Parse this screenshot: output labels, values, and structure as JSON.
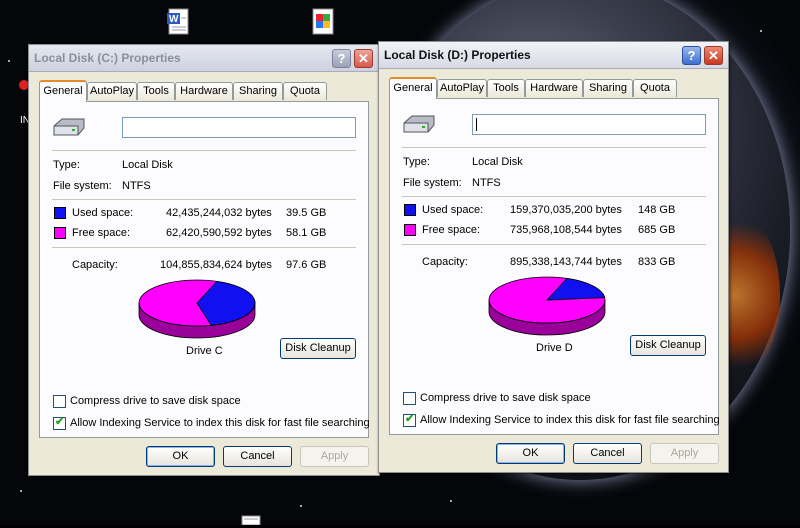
{
  "desktop": {
    "icons": [
      {
        "name": "word-document-icon"
      },
      {
        "name": "shortcut-icon"
      },
      {
        "name": "red-program-icon"
      },
      {
        "name": "notepad-icon"
      }
    ],
    "partial_label": "IN"
  },
  "windows": [
    {
      "title": "Local Disk (C:) Properties",
      "tabs": [
        "General",
        "AutoPlay",
        "Tools",
        "Hardware",
        "Sharing",
        "Quota"
      ],
      "selected_tab": "General",
      "name_value": "",
      "type_label": "Type:",
      "type_value": "Local Disk",
      "fs_label": "File system:",
      "fs_value": "NTFS",
      "used_label": "Used space:",
      "used_bytes": "42,435,244,032 bytes",
      "used_gb": "39.5 GB",
      "free_label": "Free space:",
      "free_bytes": "62,420,590,592 bytes",
      "free_gb": "58.1 GB",
      "capacity_label": "Capacity:",
      "capacity_bytes": "104,855,834,624 bytes",
      "capacity_gb": "97.6 GB",
      "used_fraction": 0.405,
      "drive_label": "Drive C",
      "cleanup_label": "Disk Cleanup",
      "compress_label": "Compress drive to save disk space",
      "compress_checked": false,
      "index_label": "Allow Indexing Service to index this disk for fast file searching",
      "index_checked": true,
      "ok_label": "OK",
      "cancel_label": "Cancel",
      "apply_label": "Apply",
      "active": false
    },
    {
      "title": "Local Disk (D:) Properties",
      "tabs": [
        "General",
        "AutoPlay",
        "Tools",
        "Hardware",
        "Sharing",
        "Quota"
      ],
      "selected_tab": "General",
      "name_value": "",
      "type_label": "Type:",
      "type_value": "Local Disk",
      "fs_label": "File system:",
      "fs_value": "NTFS",
      "used_label": "Used space:",
      "used_bytes": "159,370,035,200 bytes",
      "used_gb": "148 GB",
      "free_label": "Free space:",
      "free_bytes": "735,968,108,544 bytes",
      "free_gb": "685 GB",
      "capacity_label": "Capacity:",
      "capacity_bytes": "895,338,143,744 bytes",
      "capacity_gb": "833 GB",
      "used_fraction": 0.178,
      "drive_label": "Drive D",
      "cleanup_label": "Disk Cleanup",
      "compress_label": "Compress drive to save disk space",
      "compress_checked": false,
      "index_label": "Allow Indexing Service to index this disk for fast file searching",
      "index_checked": true,
      "ok_label": "OK",
      "cancel_label": "Cancel",
      "apply_label": "Apply",
      "active": true
    }
  ],
  "colors": {
    "used": "#1010f0",
    "free": "#ff00ff",
    "used_dark": "#00008a",
    "free_dark": "#9a009a"
  }
}
